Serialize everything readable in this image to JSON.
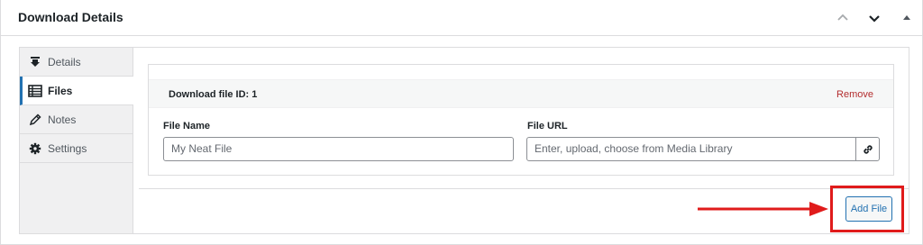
{
  "metabox": {
    "title": "Download Details",
    "controls": [
      {
        "name": "move-up-icon"
      },
      {
        "name": "move-down-icon"
      },
      {
        "name": "toggle-panel-icon"
      }
    ]
  },
  "tabs": [
    {
      "label": "Details",
      "icon": "download-icon",
      "active": false
    },
    {
      "label": "Files",
      "icon": "list-view-icon",
      "active": true
    },
    {
      "label": "Notes",
      "icon": "edit-pencil-icon",
      "active": false
    },
    {
      "label": "Settings",
      "icon": "gear-icon",
      "active": false
    }
  ],
  "file": {
    "id_label": "Download file ID: 1",
    "remove_label": "Remove",
    "name_label": "File Name",
    "name_value": "My Neat File",
    "url_label": "File URL",
    "url_placeholder": "Enter, upload, choose from Media Library",
    "url_button_icon": "link-icon"
  },
  "add_file_label": "Add File",
  "annotation": {
    "color": "#e01b1b"
  },
  "colors": {
    "accent": "#2271b1",
    "danger": "#b32d2e"
  }
}
